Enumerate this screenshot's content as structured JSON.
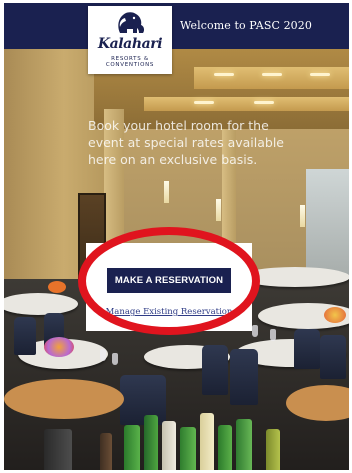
{
  "header": {
    "welcome_text": "Welcome to PASC 2020",
    "background_color": "#1a2150"
  },
  "logo": {
    "name": "Kalahari",
    "tagline": "RESORTS & CONVENTIONS",
    "icon": "elephant-icon"
  },
  "promo": {
    "text": "Book your hotel room for the event at special rates available here on an exclusive basis."
  },
  "reservation": {
    "primary_button": "MAKE A RESERVATION",
    "secondary_link": "Manage Existing Reservation",
    "button_color": "#1a2150",
    "link_color": "#2f3c86"
  },
  "annotation": {
    "shape": "red-ellipse",
    "color": "#e0141e"
  }
}
